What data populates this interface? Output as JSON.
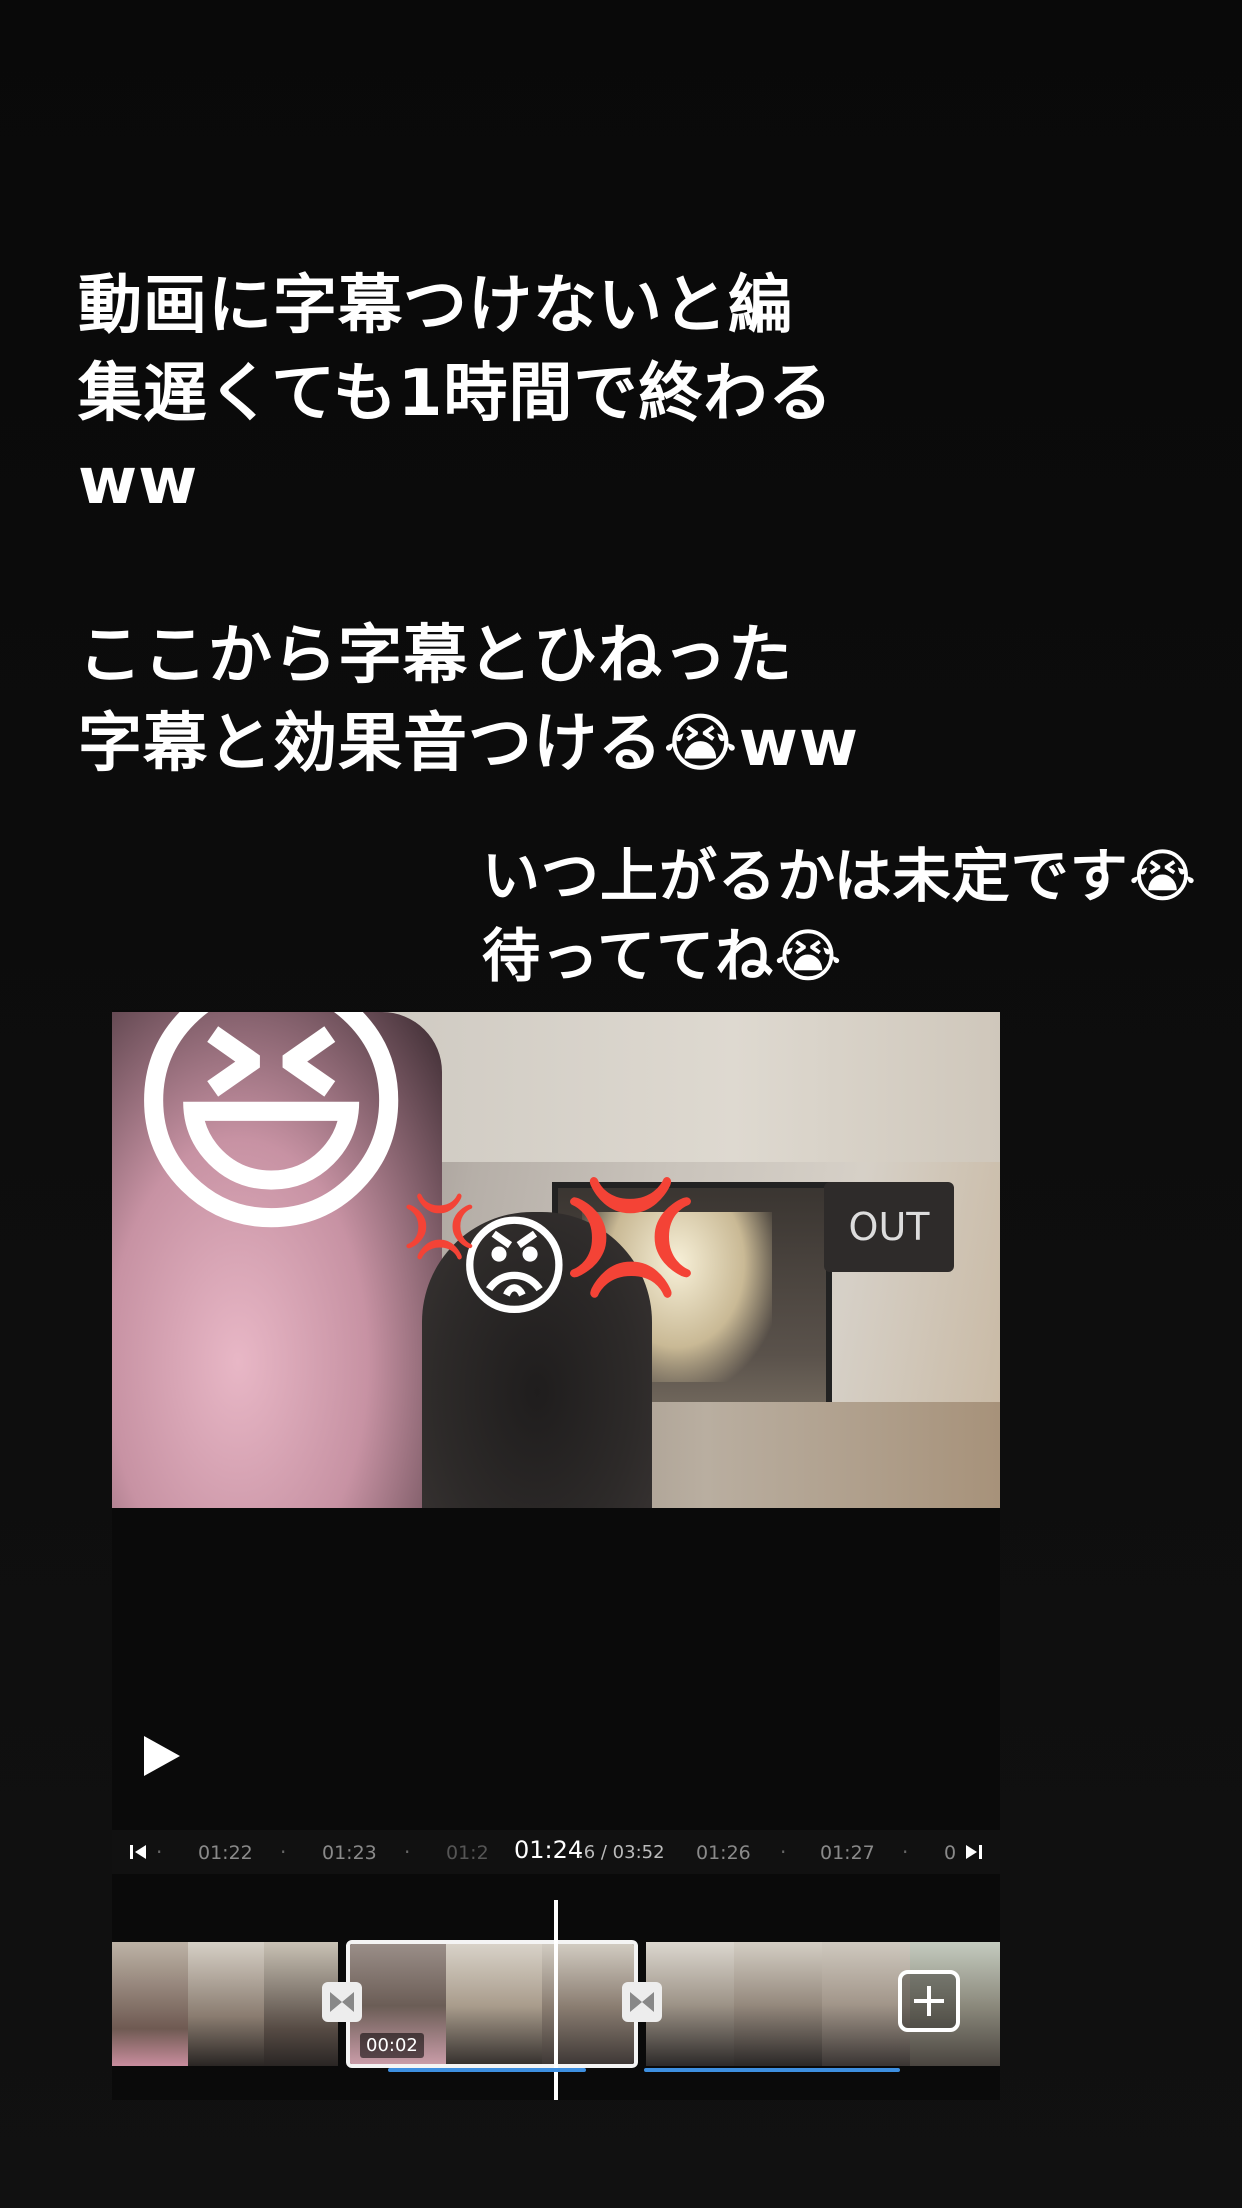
{
  "captions": {
    "first": "動画に字幕つけないと編\n集遅くても1時間で終わる\nww",
    "second": "ここから字幕とひねった\n字幕と効果音つける😭ww",
    "third": "いつ上がるかは未定です😭\n待っててね😭"
  },
  "preview": {
    "stickers": [
      "😆",
      "😡",
      "💢",
      "💢"
    ],
    "storefront_sign": "OUT"
  },
  "player": {
    "play_icon": "play-icon"
  },
  "ruler": {
    "ticks": [
      "01:22",
      "01:23",
      "01:2",
      "01:26",
      "01:27",
      "0"
    ],
    "current_time": "01:24",
    "current_time_detail": ".6 / 03:52"
  },
  "timeline": {
    "selected_clip_duration": "00:02",
    "add_label": "+"
  },
  "colors": {
    "audio_track": "#3d8fe0",
    "background": "#0b0b0b"
  }
}
